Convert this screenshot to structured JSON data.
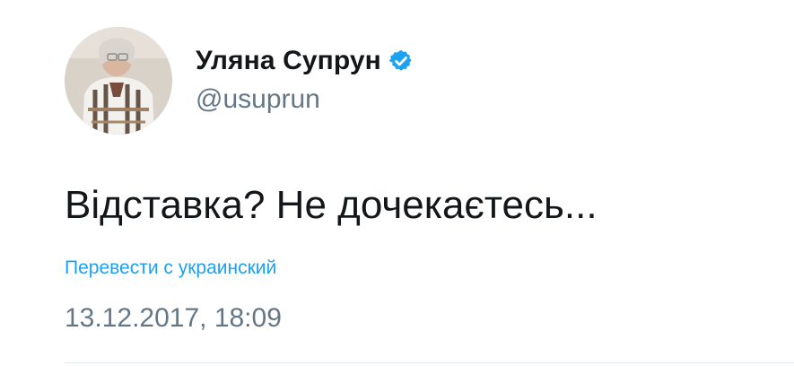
{
  "tweet": {
    "author": {
      "name": "Уляна Супрун",
      "handle": "@usuprun",
      "verified": true,
      "avatar_icon": "avatar-photo"
    },
    "text": "Відставка? Не дочекаєтесь...",
    "translate_label": "Перевести с украинский",
    "timestamp": "13.12.2017, 18:09"
  },
  "colors": {
    "text": "#14171a",
    "secondary": "#657786",
    "link": "#1da1f2",
    "verified_badge": "#1da1f2",
    "divider": "#e1e8ed"
  }
}
